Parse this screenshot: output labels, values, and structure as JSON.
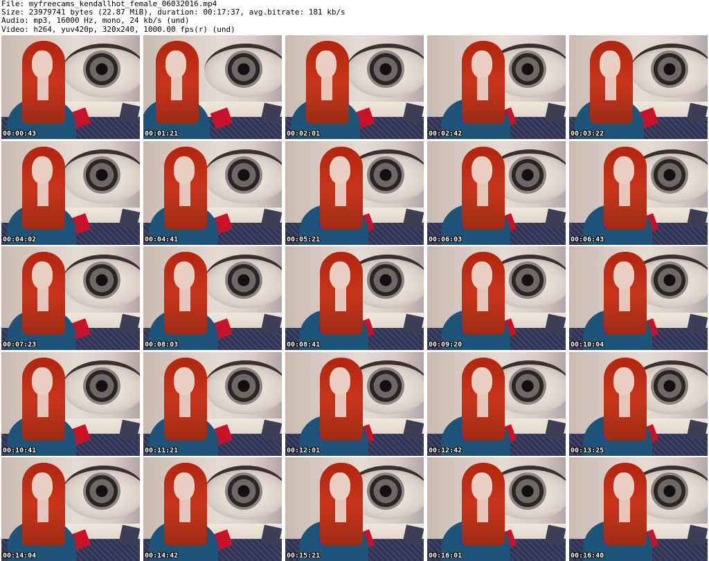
{
  "header": {
    "file_line": "File: myfreecams_kendallhot_female_06032016.mp4",
    "size_line": "Size: 23979741 bytes (22.87 MiB), duration: 00:17:37, avg.bitrate: 181 kb/s",
    "audio_line": "Audio: mp3, 16000 Hz, mono, 24 kb/s (und)",
    "video_line": "Video: h264, yuv420p, 320x240, 1000.00 fps(r) (und)"
  },
  "thumbnails": [
    {
      "timestamp": "00:00:43"
    },
    {
      "timestamp": "00:01:21"
    },
    {
      "timestamp": "00:02:01"
    },
    {
      "timestamp": "00:02:42"
    },
    {
      "timestamp": "00:03:22"
    },
    {
      "timestamp": "00:04:02"
    },
    {
      "timestamp": "00:04:41"
    },
    {
      "timestamp": "00:05:21"
    },
    {
      "timestamp": "00:06:03"
    },
    {
      "timestamp": "00:06:43"
    },
    {
      "timestamp": "00:07:23"
    },
    {
      "timestamp": "00:08:03"
    },
    {
      "timestamp": "00:08:41"
    },
    {
      "timestamp": "00:09:20"
    },
    {
      "timestamp": "00:10:04"
    },
    {
      "timestamp": "00:10:41"
    },
    {
      "timestamp": "00:11:21"
    },
    {
      "timestamp": "00:12:01"
    },
    {
      "timestamp": "00:12:42"
    },
    {
      "timestamp": "00:13:25"
    },
    {
      "timestamp": "00:14:04"
    },
    {
      "timestamp": "00:14:42"
    },
    {
      "timestamp": "00:15:21"
    },
    {
      "timestamp": "00:16:01"
    },
    {
      "timestamp": "00:16:40"
    }
  ],
  "colors": {
    "background": "#ffffff",
    "header_text": "#000000",
    "timestamp_text": "#ffffff",
    "timestamp_outline": "#000000"
  }
}
